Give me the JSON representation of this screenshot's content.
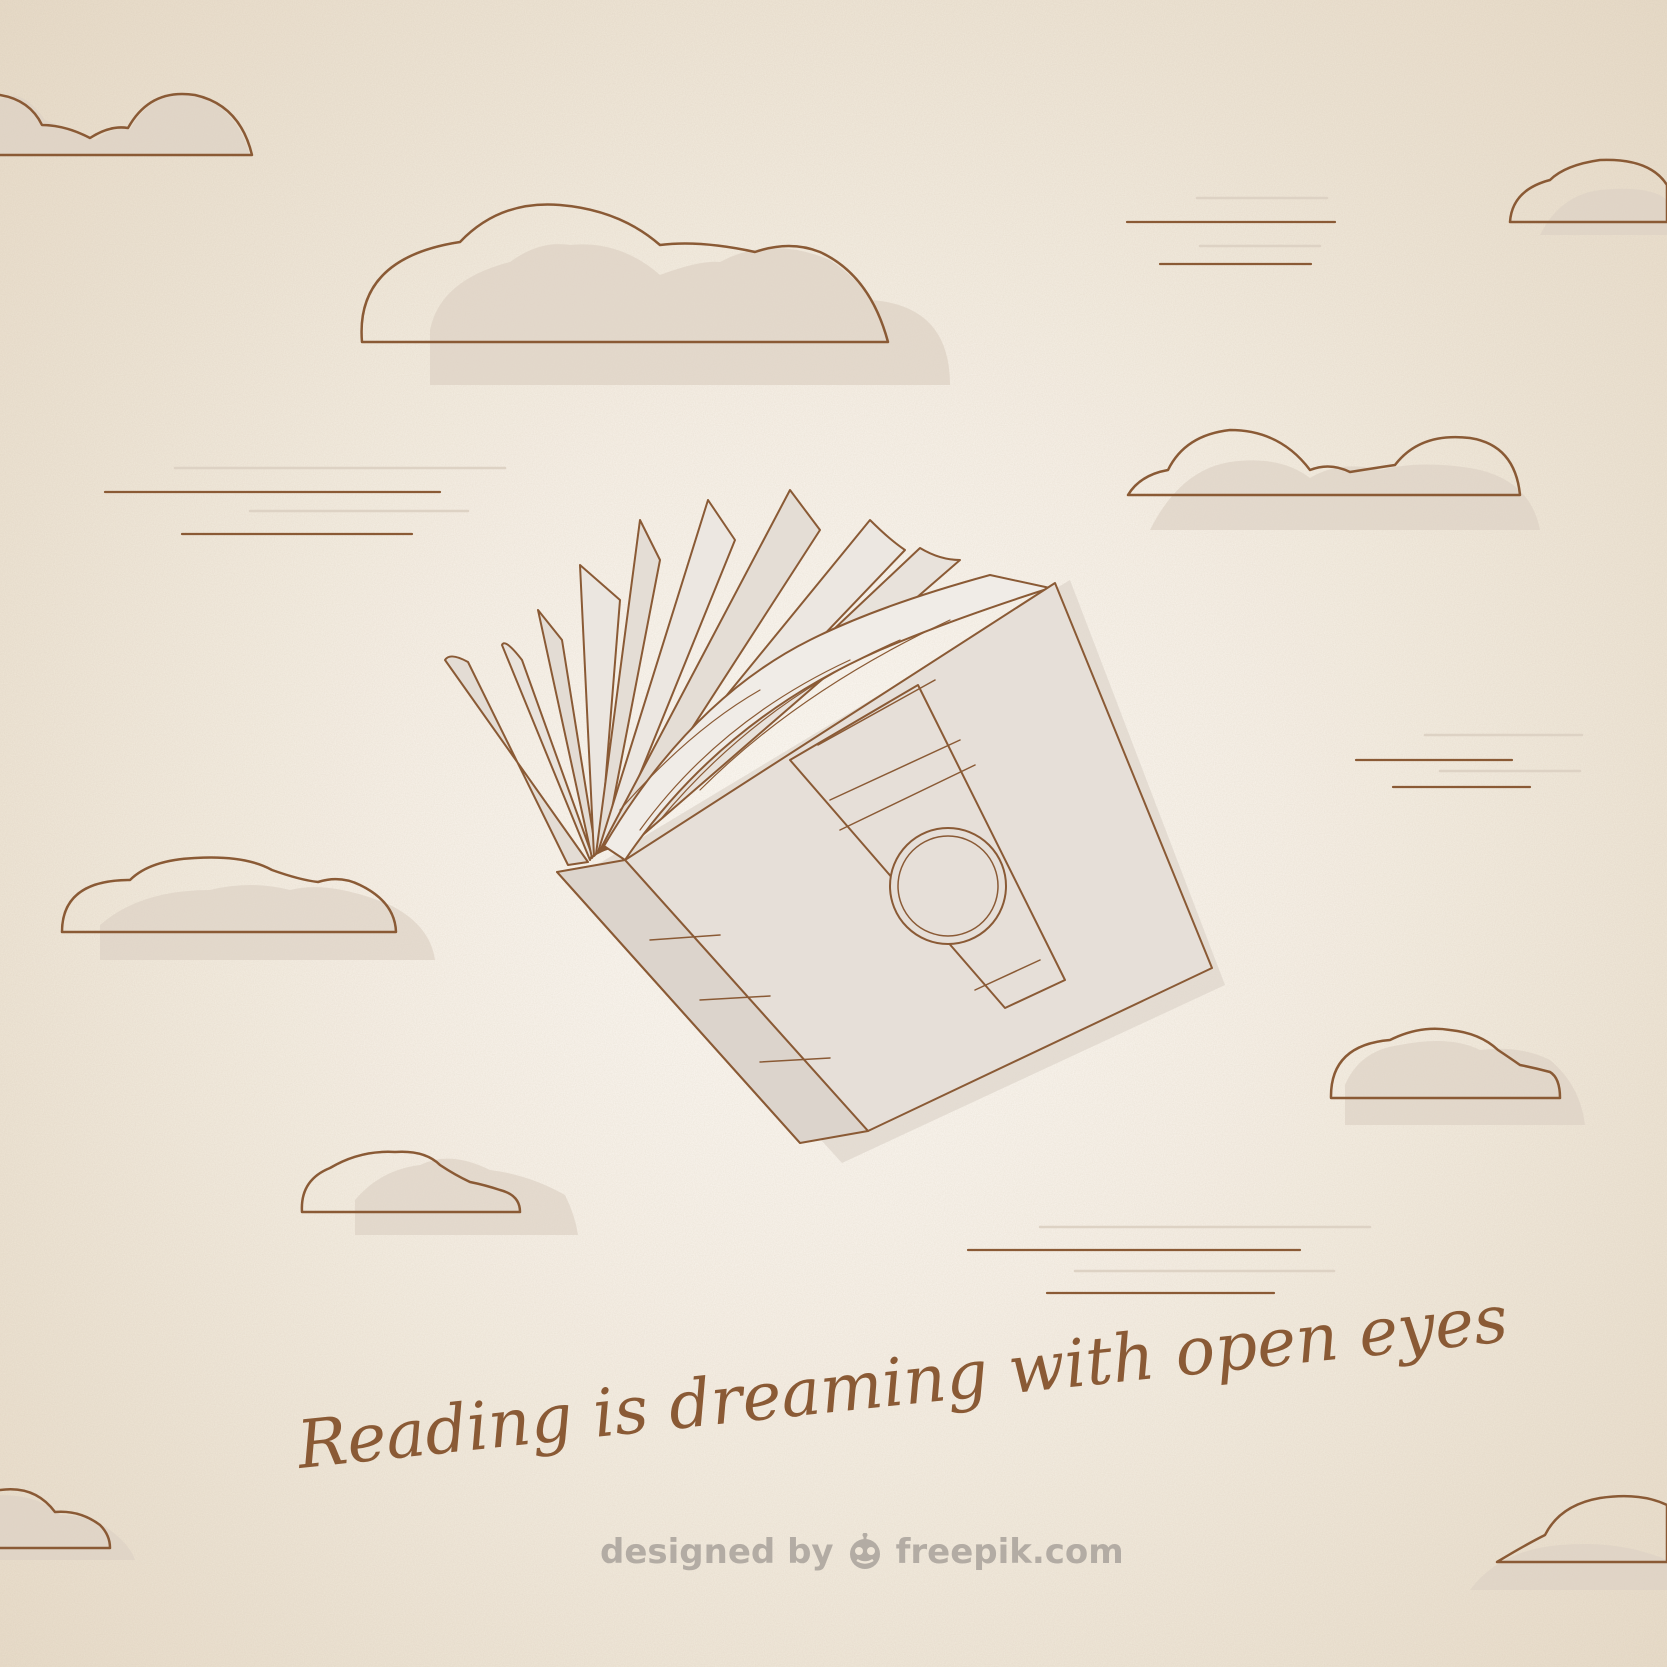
{
  "illustration": {
    "quote": "Reading is dreaming with open eyes",
    "credit_prefix": "designed by",
    "credit_brand": "freepik.com",
    "subject": "flying open book among outlined clouds",
    "colors": {
      "background": "#efe6d8",
      "line": "#8a5a35",
      "cloud_shadow": "#ded3c5",
      "book_fill": "#e6dfd8",
      "text": "#8a5a35",
      "credit": "#b3aca4"
    }
  }
}
